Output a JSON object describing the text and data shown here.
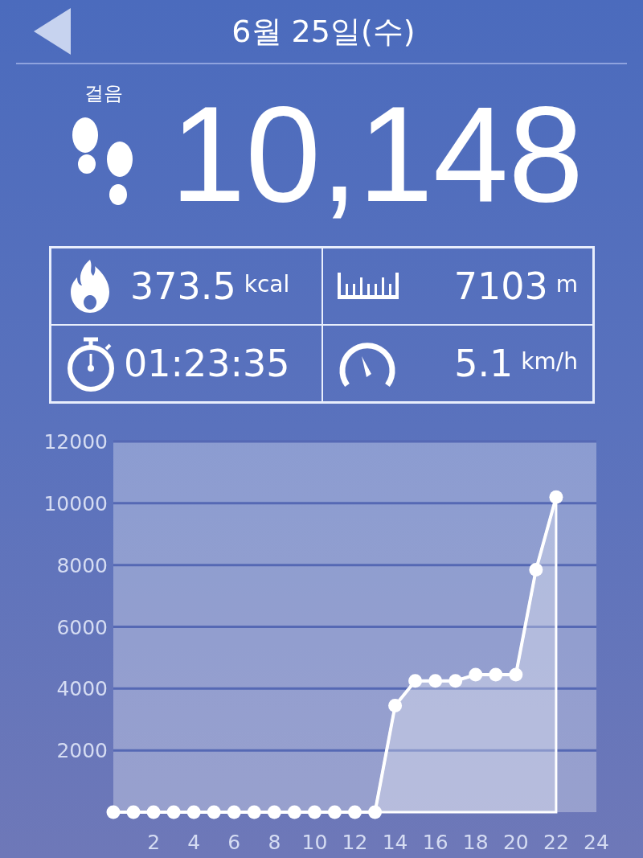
{
  "header": {
    "title": "6월 25일(수)"
  },
  "steps": {
    "label": "걸음",
    "value": "10,148"
  },
  "stats": [
    {
      "kind": "fire",
      "value": "373.5",
      "unit": "kcal"
    },
    {
      "kind": "ruler",
      "value": "7103",
      "unit": "m"
    },
    {
      "kind": "stopwatch",
      "value": "01:23:35"
    },
    {
      "kind": "speedometer",
      "value": "5.1",
      "unit": "km/h"
    }
  ],
  "chart": {
    "chart_data": {
      "type": "area",
      "x": [
        0,
        1,
        2,
        3,
        4,
        5,
        6,
        7,
        8,
        9,
        10,
        11,
        12,
        13,
        14,
        15,
        16,
        17,
        18,
        19,
        20,
        21,
        22
      ],
      "series": [
        {
          "color": "#ffffff",
          "values": [
            0,
            0,
            0,
            0,
            0,
            0,
            0,
            0,
            0,
            0,
            0,
            0,
            0,
            0,
            3450,
            4250,
            4250,
            4250,
            4450,
            4450,
            4450,
            7850,
            10200
          ]
        }
      ],
      "grid": true,
      "xlim": [
        0,
        24
      ],
      "ylim": [
        0,
        12000
      ],
      "xticks": [
        2,
        4,
        6,
        8,
        10,
        12,
        14,
        16,
        18,
        20,
        22,
        24
      ],
      "yticks": [
        2000,
        4000,
        6000,
        8000,
        10000,
        12000
      ]
    }
  }
}
